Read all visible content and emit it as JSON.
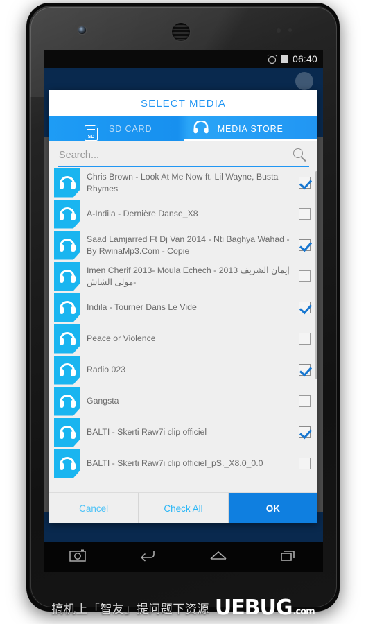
{
  "statusbar": {
    "time": "06:40",
    "alarm_icon": "alarm-icon",
    "battery_icon": "battery-icon"
  },
  "dialog": {
    "title": "SELECT MEDIA",
    "tabs": [
      {
        "label": "SD CARD",
        "icon": "sd-card-icon",
        "active": false
      },
      {
        "label": "MEDIA STORE",
        "icon": "headphones-icon",
        "active": true
      }
    ],
    "search": {
      "placeholder": "Search...",
      "value": "",
      "icon": "search-icon"
    },
    "list": [
      {
        "title": "Chris Brown - Look At Me Now ft. Lil Wayne, Busta Rhymes",
        "checked": true
      },
      {
        "title": "A-Indila - Dernière Danse_X8",
        "checked": false
      },
      {
        "title": "Saad Lamjarred Ft Dj Van 2014 - Nti Baghya Wahad - By RwinaMp3.Com - Copie",
        "checked": true
      },
      {
        "title": "Imen Cherif 2013- Moula Echech - إيمان الشريف 2013 -مولى الشاش",
        "checked": false
      },
      {
        "title": "Indila - Tourner Dans Le Vide",
        "checked": true
      },
      {
        "title": "Peace or Violence",
        "checked": false
      },
      {
        "title": "Radio 023",
        "checked": true
      },
      {
        "title": "Gangsta",
        "checked": false
      },
      {
        "title": "BALTI - Skerti Raw7i clip officiel",
        "checked": true
      },
      {
        "title": "BALTI - Skerti Raw7i clip officiel_pS._X8.0_0.0",
        "checked": false
      }
    ],
    "buttons": {
      "cancel": "Cancel",
      "check_all": "Check All",
      "ok": "OK"
    }
  },
  "navbar": {
    "camera": "camera-icon",
    "back": "back-icon",
    "home": "home-icon",
    "recents": "recents-icon"
  },
  "watermark": {
    "text": "搞机上「智友」提问题下资源",
    "logo": "UEBUG",
    "logo_suffix": ".com"
  },
  "colors": {
    "accent": "#2196F3",
    "tab_bar": "#1e9cf5",
    "file_icon": "#19B5F0",
    "ok_button": "#0f7fe0",
    "app_background": "#0d3c70"
  }
}
